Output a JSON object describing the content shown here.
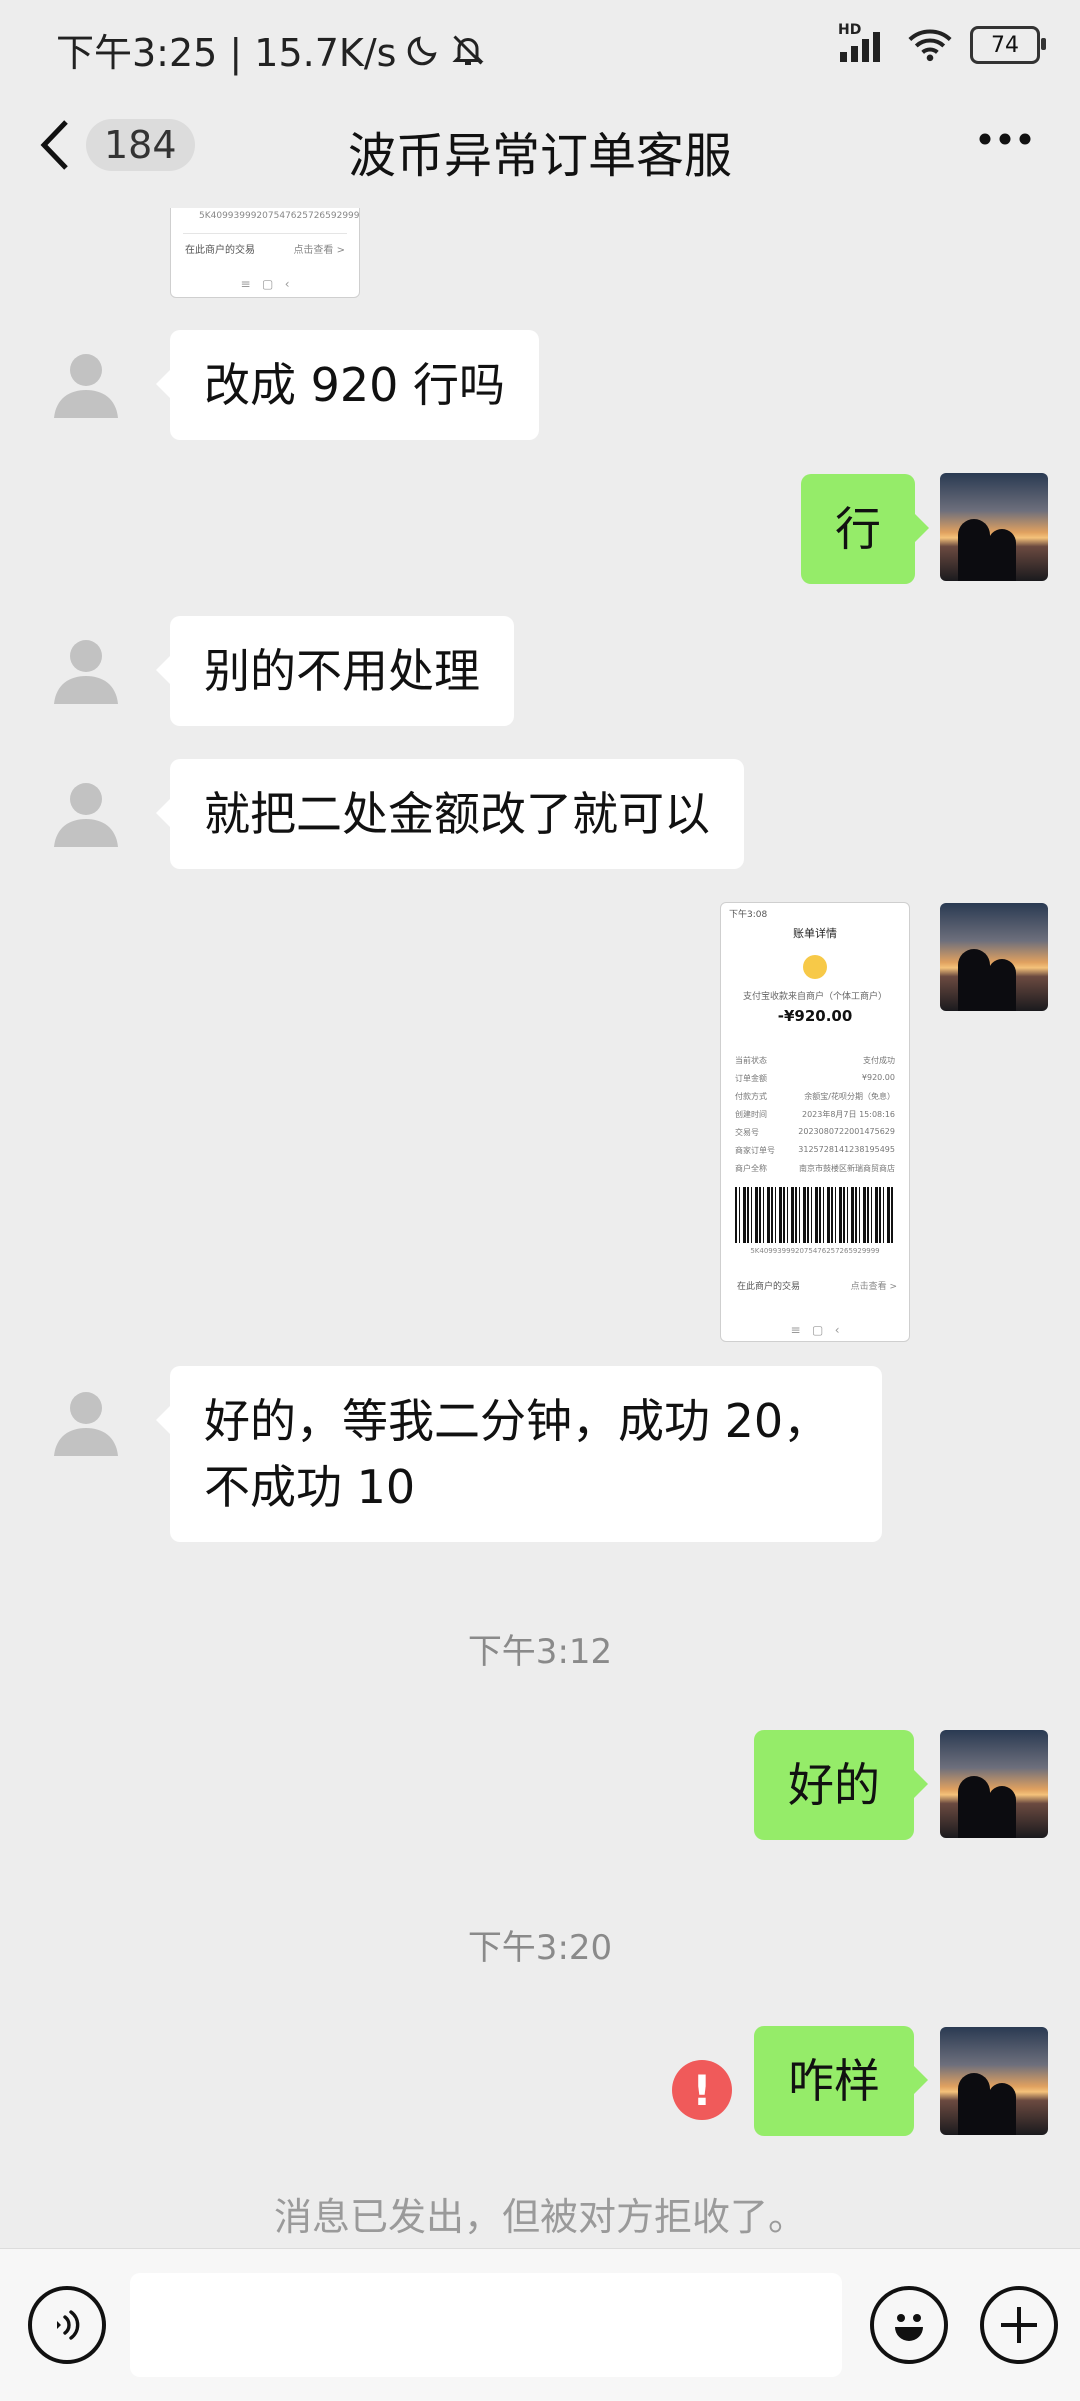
{
  "status_bar": {
    "time_speed": "下午3:25 | 15.7K/s",
    "battery": "74",
    "hd": "HD",
    "icons": [
      "moon-icon",
      "bell-off-icon",
      "signal-icon",
      "wifi-icon",
      "battery-icon"
    ]
  },
  "header": {
    "unread_count": "184",
    "title": "波币异常订单客服",
    "icons": [
      "back-chevron-icon",
      "more-dots-icon"
    ]
  },
  "messages": [
    {
      "type": "image",
      "from": "self",
      "partial": true,
      "lines": [
        "5K409939992075476257265929999",
        "在此商户的交易",
        "点击查看 >"
      ]
    },
    {
      "type": "text",
      "from": "other",
      "text": "改成 920 行吗"
    },
    {
      "type": "text",
      "from": "self",
      "text": "行"
    },
    {
      "type": "text",
      "from": "other",
      "text": "别的不用处理"
    },
    {
      "type": "text",
      "from": "other",
      "text": "就把二处金额改了就可以"
    },
    {
      "type": "image",
      "from": "self",
      "receipt": {
        "status_time": "下午3:08",
        "header": "账单详情",
        "merchant": "支付宝收款来自商户（个体工商户）",
        "amount": "-¥920.00",
        "rows": [
          [
            "当前状态",
            "支付成功"
          ],
          [
            "订单金额",
            "¥920.00"
          ],
          [
            "付款方式",
            "余额宝/花呗分期（免息）"
          ],
          [
            "创建时间",
            "2023年8月7日 15:08:16"
          ],
          [
            "交易号",
            "2023080722001475629"
          ],
          [
            "商家订单号",
            "3125728141238195495"
          ],
          [
            "商户全称",
            "南京市鼓楼区新瑞商贸商店"
          ]
        ],
        "barcode_number": "5K409939992075476257265929999",
        "footer_left": "在此商户的交易",
        "footer_right": "点击查看 >"
      }
    },
    {
      "type": "text",
      "from": "other",
      "text": "好的，等我二分钟，成功 20，不成功 10"
    },
    {
      "type": "time",
      "text": "下午3:12"
    },
    {
      "type": "text",
      "from": "self",
      "text": "好的"
    },
    {
      "type": "time",
      "text": "下午3:20"
    },
    {
      "type": "text",
      "from": "self",
      "text": "咋样",
      "failed": true
    }
  ],
  "rejected_notice": "消息已发出，但被对方拒收了。",
  "input": {
    "value": "",
    "icons": [
      "voice-icon",
      "emoji-icon",
      "add-icon"
    ]
  },
  "colors": {
    "background": "#ededed",
    "bubble_self": "#95ec69",
    "bubble_other": "#ffffff",
    "error": "#f05a5a"
  }
}
